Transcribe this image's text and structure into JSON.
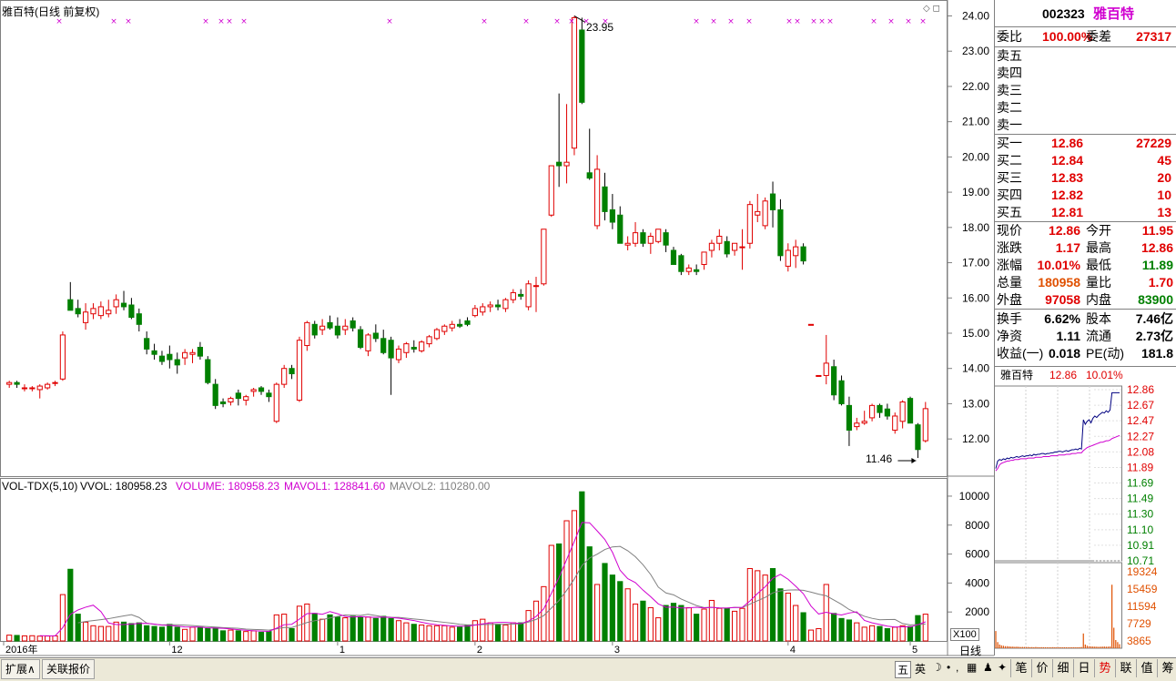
{
  "chart_header": {
    "title": "雅百特(日线 前复权)",
    "vol_title": "VOL-TDX(5,10)",
    "vvol": "VVOL: 180958.23",
    "volume": "VOLUME: 180958.23",
    "mavol1": "MAVOL1: 128841.60",
    "mavol2": "MAVOL2: 110280.00",
    "high_label": "23.95",
    "low_label": "11.46",
    "vol_unit": "X100",
    "period": "日线"
  },
  "colors": {
    "up": "#e00000",
    "down": "#008000",
    "ma1": "#d000d0",
    "ma2": "#808080",
    "accent": "#e00000"
  },
  "chart_data": [
    {
      "type": "candlestick",
      "title": "雅百特(日线 前复权)",
      "ylim": [
        11.1,
        24.4
      ],
      "yticks": [
        "24.00",
        "23.00",
        "22.00",
        "21.00",
        "20.00",
        "19.00",
        "18.00",
        "17.00",
        "16.00",
        "15.00",
        "14.00",
        "13.00",
        "12.00"
      ],
      "xticks": [
        {
          "label": "2016年",
          "index": 0
        },
        {
          "label": "12",
          "index": 21
        },
        {
          "label": "1",
          "index": 43
        },
        {
          "label": "2",
          "index": 61
        },
        {
          "label": "3",
          "index": 79
        },
        {
          "label": "4",
          "index": 102
        },
        {
          "label": "5",
          "index": 118
        }
      ],
      "ohlc": [
        [
          13.55,
          13.65,
          13.45,
          13.6
        ],
        [
          13.6,
          13.65,
          13.45,
          13.55
        ],
        [
          13.45,
          13.55,
          13.35,
          13.45
        ],
        [
          13.45,
          13.5,
          13.35,
          13.45
        ],
        [
          13.4,
          13.55,
          13.15,
          13.5
        ],
        [
          13.45,
          13.6,
          13.4,
          13.55
        ],
        [
          13.6,
          13.65,
          13.5,
          13.6
        ],
        [
          13.7,
          15.05,
          13.65,
          14.95
        ],
        [
          15.95,
          16.45,
          15.7,
          15.65
        ],
        [
          15.7,
          15.95,
          15.45,
          15.55
        ],
        [
          15.3,
          15.85,
          15.1,
          15.6
        ],
        [
          15.55,
          15.85,
          15.4,
          15.7
        ],
        [
          15.5,
          15.9,
          15.4,
          15.75
        ],
        [
          15.55,
          15.95,
          15.45,
          15.65
        ],
        [
          15.75,
          16.1,
          15.55,
          15.95
        ],
        [
          15.85,
          16.2,
          15.65,
          15.75
        ],
        [
          15.8,
          16.0,
          15.4,
          15.45
        ],
        [
          15.55,
          15.7,
          15.05,
          15.25
        ],
        [
          14.85,
          15.05,
          14.4,
          14.55
        ],
        [
          14.5,
          14.7,
          14.25,
          14.4
        ],
        [
          14.35,
          14.5,
          14.1,
          14.2
        ],
        [
          14.4,
          14.65,
          14.0,
          14.25
        ],
        [
          14.25,
          14.45,
          13.85,
          14.1
        ],
        [
          14.3,
          14.55,
          14.1,
          14.45
        ],
        [
          14.4,
          14.55,
          14.15,
          14.45
        ],
        [
          14.6,
          14.75,
          14.25,
          14.35
        ],
        [
          14.25,
          14.35,
          13.55,
          13.6
        ],
        [
          13.55,
          13.7,
          12.85,
          12.95
        ],
        [
          13.05,
          13.15,
          12.9,
          13.0
        ],
        [
          13.05,
          13.2,
          12.95,
          13.15
        ],
        [
          13.3,
          13.4,
          12.95,
          13.15
        ],
        [
          13.1,
          13.25,
          12.95,
          13.2
        ],
        [
          13.35,
          13.45,
          13.2,
          13.4
        ],
        [
          13.45,
          13.5,
          13.25,
          13.35
        ],
        [
          13.3,
          13.4,
          13.05,
          13.2
        ],
        [
          12.5,
          13.6,
          12.45,
          13.55
        ],
        [
          13.55,
          14.1,
          13.45,
          14.0
        ],
        [
          14.0,
          14.1,
          13.7,
          13.85
        ],
        [
          13.1,
          14.9,
          13.05,
          14.8
        ],
        [
          14.65,
          15.35,
          14.5,
          15.3
        ],
        [
          15.25,
          15.35,
          14.85,
          14.95
        ],
        [
          15.1,
          15.4,
          14.95,
          15.2
        ],
        [
          15.3,
          15.5,
          15.1,
          15.15
        ],
        [
          15.2,
          15.45,
          14.85,
          14.95
        ],
        [
          15.1,
          15.4,
          14.95,
          15.2
        ],
        [
          15.35,
          15.45,
          15.05,
          15.15
        ],
        [
          15.1,
          15.2,
          14.55,
          14.6
        ],
        [
          14.5,
          15.0,
          14.35,
          14.95
        ],
        [
          15.0,
          15.25,
          14.75,
          14.85
        ],
        [
          14.85,
          15.1,
          14.4,
          14.45
        ],
        [
          14.8,
          14.9,
          13.25,
          14.3
        ],
        [
          14.25,
          14.65,
          14.15,
          14.55
        ],
        [
          14.45,
          14.75,
          14.3,
          14.7
        ],
        [
          14.6,
          14.8,
          14.45,
          14.55
        ],
        [
          14.5,
          14.8,
          14.45,
          14.75
        ],
        [
          14.7,
          14.95,
          14.6,
          14.9
        ],
        [
          14.85,
          15.15,
          14.8,
          15.1
        ],
        [
          15.05,
          15.25,
          14.95,
          15.2
        ],
        [
          15.15,
          15.35,
          15.05,
          15.25
        ],
        [
          15.25,
          15.4,
          15.15,
          15.2
        ],
        [
          15.35,
          15.45,
          15.2,
          15.25
        ],
        [
          15.5,
          15.8,
          15.45,
          15.7
        ],
        [
          15.6,
          15.85,
          15.5,
          15.75
        ],
        [
          15.75,
          15.9,
          15.6,
          15.8
        ],
        [
          15.8,
          15.95,
          15.65,
          15.75
        ],
        [
          15.7,
          16.0,
          15.6,
          15.95
        ],
        [
          15.95,
          16.25,
          15.85,
          16.15
        ],
        [
          16.1,
          16.25,
          15.95,
          16.05
        ],
        [
          15.75,
          16.5,
          15.65,
          16.4
        ],
        [
          16.35,
          16.6,
          15.6,
          16.35
        ],
        [
          16.4,
          17.95,
          16.35,
          17.95
        ],
        [
          18.35,
          19.75,
          18.3,
          19.75
        ],
        [
          19.85,
          21.8,
          19.15,
          19.75
        ],
        [
          19.75,
          21.5,
          19.25,
          19.85
        ],
        [
          20.25,
          24.0,
          20.05,
          23.95
        ],
        [
          23.6,
          23.95,
          21.5,
          21.55
        ],
        [
          19.55,
          20.8,
          19.35,
          19.4
        ],
        [
          18.05,
          20.05,
          17.95,
          19.65
        ],
        [
          19.15,
          19.55,
          18.2,
          18.45
        ],
        [
          18.5,
          18.95,
          17.95,
          18.15
        ],
        [
          18.35,
          18.6,
          17.55,
          17.55
        ],
        [
          17.5,
          17.75,
          17.35,
          17.55
        ],
        [
          17.55,
          18.15,
          17.45,
          17.85
        ],
        [
          17.85,
          17.95,
          17.45,
          17.55
        ],
        [
          17.55,
          17.85,
          17.25,
          17.75
        ],
        [
          17.6,
          17.95,
          17.55,
          17.95
        ],
        [
          17.85,
          17.95,
          17.3,
          17.5
        ],
        [
          17.35,
          17.45,
          16.95,
          16.95
        ],
        [
          17.2,
          17.25,
          16.65,
          16.75
        ],
        [
          16.75,
          16.95,
          16.65,
          16.85
        ],
        [
          16.8,
          16.95,
          16.65,
          16.75
        ],
        [
          16.95,
          17.3,
          16.8,
          17.3
        ],
        [
          17.35,
          17.65,
          17.15,
          17.55
        ],
        [
          17.55,
          17.95,
          17.35,
          17.75
        ],
        [
          17.6,
          17.75,
          17.15,
          17.25
        ],
        [
          17.35,
          17.55,
          17.2,
          17.55
        ],
        [
          17.45,
          17.95,
          16.8,
          17.45
        ],
        [
          17.55,
          18.75,
          17.4,
          18.65
        ],
        [
          18.35,
          18.95,
          18.15,
          18.45
        ],
        [
          18.05,
          18.85,
          17.95,
          18.75
        ],
        [
          18.95,
          19.3,
          18.0,
          18.5
        ],
        [
          18.5,
          18.8,
          17.05,
          17.2
        ],
        [
          16.9,
          17.55,
          16.75,
          17.35
        ],
        [
          17.2,
          17.65,
          16.85,
          17.45
        ],
        [
          17.45,
          17.55,
          16.95,
          17.05
        ],
        [
          15.25,
          15.25,
          15.25,
          15.25
        ],
        [
          13.8,
          13.8,
          13.8,
          13.8
        ],
        [
          13.8,
          14.95,
          13.55,
          14.15
        ],
        [
          14.05,
          14.25,
          13.1,
          13.25
        ],
        [
          13.65,
          13.8,
          12.95,
          13.0
        ],
        [
          12.95,
          13.2,
          11.8,
          12.25
        ],
        [
          12.35,
          12.6,
          12.25,
          12.45
        ],
        [
          12.45,
          12.8,
          12.4,
          12.5
        ],
        [
          12.6,
          13.0,
          12.5,
          12.95
        ],
        [
          12.95,
          13.0,
          12.6,
          12.75
        ],
        [
          12.85,
          13.0,
          12.55,
          12.65
        ],
        [
          12.25,
          12.75,
          12.15,
          12.65
        ],
        [
          12.5,
          13.1,
          12.3,
          13.05
        ],
        [
          13.15,
          13.2,
          12.45,
          12.45
        ],
        [
          12.4,
          12.45,
          11.46,
          11.7
        ],
        [
          11.95,
          13.05,
          11.9,
          12.86
        ]
      ]
    },
    {
      "type": "bar",
      "title": "VOL-TDX(5,10)",
      "ylim": [
        0,
        10500
      ],
      "yticks": [
        "10000",
        "8000",
        "6000",
        "4000",
        "2000"
      ],
      "unit": "X100",
      "values": [
        400,
        380,
        350,
        360,
        330,
        340,
        350,
        3200,
        4950,
        1850,
        1300,
        1050,
        1000,
        1000,
        1300,
        1300,
        1200,
        1250,
        1050,
        1000,
        950,
        1150,
        950,
        800,
        950,
        950,
        850,
        900,
        700,
        750,
        700,
        650,
        700,
        600,
        650,
        1800,
        1850,
        850,
        2400,
        2550,
        1900,
        1500,
        1800,
        1650,
        1600,
        1700,
        1650,
        1650,
        1550,
        1700,
        1550,
        1400,
        1250,
        1150,
        1100,
        1050,
        1050,
        1050,
        950,
        950,
        1100,
        1400,
        1500,
        1250,
        1150,
        1100,
        1250,
        1250,
        2100,
        2750,
        3750,
        6600,
        6700,
        8300,
        9000,
        10300,
        6500,
        3900,
        5350,
        4550,
        4100,
        3600,
        2550,
        2750,
        2300,
        1600,
        2450,
        2600,
        2450,
        2300,
        1850,
        2200,
        2800,
        2250,
        2250,
        2050,
        2250,
        5000,
        4850,
        4550,
        5000,
        3600,
        3300,
        2450,
        1950,
        750,
        850,
        3900,
        1900,
        1550,
        1450,
        1250,
        950,
        1050,
        1000,
        850,
        950,
        1050,
        1000,
        1750,
        1850
      ],
      "mavol1_label": "MAVOL1",
      "mavol2_label": "MAVOL2"
    },
    {
      "type": "line",
      "title": "雅百特 12.86 10.01%",
      "yticks_up": [
        "12.86",
        "12.67",
        "12.47",
        "12.27",
        "12.08",
        "11.89"
      ],
      "yticks_down": [
        "11.69",
        "11.49",
        "11.30",
        "11.10",
        "10.91",
        "10.71"
      ],
      "vol_ticks": [
        "19324",
        "15459",
        "11594",
        "7729",
        "3865"
      ],
      "ylim": [
        10.62,
        12.95
      ],
      "price": [
        11.85,
        11.95,
        11.97,
        11.96,
        11.98,
        11.97,
        11.99,
        11.98,
        12.0,
        11.99,
        12.0,
        12.01,
        12.0,
        12.01,
        12.02,
        12.01,
        12.02,
        12.02,
        12.03,
        12.02,
        12.04,
        12.03,
        12.04,
        12.04,
        12.05,
        12.05,
        12.04,
        12.05,
        12.05,
        12.06,
        12.06,
        12.07,
        12.07,
        12.08,
        12.08,
        12.07,
        12.08,
        12.09,
        12.08,
        12.09,
        12.1,
        12.1,
        12.11,
        12.1,
        12.12,
        12.11,
        12.5,
        12.44,
        12.48,
        12.5,
        12.46,
        12.52,
        12.55,
        12.53,
        12.56,
        12.58,
        12.6,
        12.59,
        12.62,
        12.6,
        12.63,
        12.86,
        12.86,
        12.86,
        12.86,
        12.86
      ],
      "avg": [
        11.82,
        11.85,
        11.9,
        11.92,
        11.93,
        11.94,
        11.95,
        11.95,
        11.96,
        11.96,
        11.97,
        11.97,
        11.97,
        11.98,
        11.98,
        11.98,
        11.98,
        11.99,
        11.99,
        11.99,
        11.99,
        12.0,
        12.0,
        12.0,
        12.0,
        12.01,
        12.01,
        12.01,
        12.01,
        12.02,
        12.02,
        12.02,
        12.02,
        12.03,
        12.03,
        12.03,
        12.03,
        12.04,
        12.04,
        12.04,
        12.05,
        12.05,
        12.05,
        12.06,
        12.06,
        12.06,
        12.09,
        12.11,
        12.13,
        12.14,
        12.15,
        12.16,
        12.17,
        12.18,
        12.19,
        12.2,
        12.2,
        12.21,
        12.22,
        12.22,
        12.23,
        12.25,
        12.26,
        12.27,
        12.28,
        12.29
      ],
      "volume": [
        4200,
        1500,
        900,
        700,
        600,
        500,
        500,
        450,
        400,
        400,
        350,
        380,
        350,
        300,
        320,
        300,
        280,
        300,
        260,
        280,
        250,
        300,
        260,
        240,
        260,
        250,
        230,
        240,
        230,
        220,
        260,
        230,
        240,
        250,
        230,
        220,
        240,
        230,
        220,
        230,
        240,
        250,
        230,
        240,
        260,
        300,
        3600,
        900,
        600,
        500,
        450,
        420,
        400,
        380,
        350,
        380,
        400,
        420,
        380,
        400,
        450,
        15500,
        5000,
        2000,
        1500,
        1000
      ]
    }
  ],
  "quote": {
    "code": "002323",
    "name": "雅百特",
    "weibi_label": "委比",
    "weibi_value": "100.00%",
    "weicha_label": "委差",
    "weicha_value": "27317",
    "sells": [
      {
        "label": "卖五",
        "price": "",
        "vol": ""
      },
      {
        "label": "卖四",
        "price": "",
        "vol": ""
      },
      {
        "label": "卖三",
        "price": "",
        "vol": ""
      },
      {
        "label": "卖二",
        "price": "",
        "vol": ""
      },
      {
        "label": "卖一",
        "price": "",
        "vol": ""
      }
    ],
    "buys": [
      {
        "label": "买一",
        "price": "12.86",
        "vol": "27229"
      },
      {
        "label": "买二",
        "price": "12.84",
        "vol": "45"
      },
      {
        "label": "买三",
        "price": "12.83",
        "vol": "20"
      },
      {
        "label": "买四",
        "price": "12.82",
        "vol": "10"
      },
      {
        "label": "买五",
        "price": "12.81",
        "vol": "13"
      }
    ],
    "stats": [
      {
        "l1": "现价",
        "v1": "12.86",
        "l2": "今开",
        "v2": "11.95"
      },
      {
        "l1": "涨跌",
        "v1": "1.17",
        "l2": "最高",
        "v2": "12.86"
      },
      {
        "l1": "涨幅",
        "v1": "10.01%",
        "l2": "最低",
        "v2": "11.89"
      },
      {
        "l1": "总量",
        "v1": "180958",
        "l2": "量比",
        "v2": "1.70"
      },
      {
        "l1": "外盘",
        "v1": "97058",
        "l2": "内盘",
        "v2": "83900"
      }
    ],
    "fund": [
      {
        "l1": "换手",
        "v1": "6.62%",
        "l2": "股本",
        "v2": "7.46亿"
      },
      {
        "l1": "净资",
        "v1": "1.11",
        "l2": "流通",
        "v2": "2.73亿"
      },
      {
        "l1": "收益(一)",
        "v1": "0.018",
        "l2": "PE(动)",
        "v2": "181.8"
      }
    ],
    "mini_title": "雅百特",
    "mini_price": "12.86",
    "mini_pct": "10.01%"
  },
  "bottom": {
    "tab1": "扩展∧",
    "tab2": "关联报价",
    "ime1": "五",
    "ime2": "英",
    "right_tabs": [
      "笔",
      "价",
      "细",
      "日",
      "势",
      "联",
      "值",
      "筹"
    ],
    "right_active": 4
  }
}
